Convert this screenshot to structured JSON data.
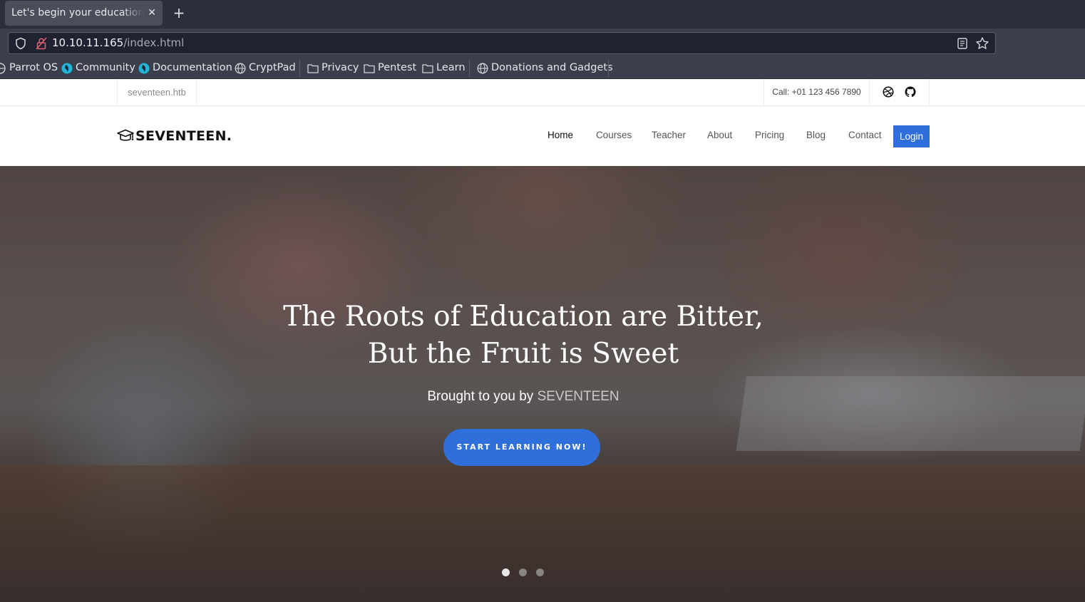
{
  "browser": {
    "tab_title": "Let's begin your education with us!",
    "tab_close": "✕",
    "new_tab": "+",
    "url_host": "10.10.11.165",
    "url_path": "/index.html"
  },
  "bookmarks": [
    {
      "label": "Parrot OS",
      "icon": "parrot-icon"
    },
    {
      "label": "Community",
      "icon": "parrot-icon"
    },
    {
      "label": "Documentation",
      "icon": "parrot-icon"
    },
    {
      "label": "CryptPad",
      "icon": "globe-icon"
    },
    {
      "label": "Privacy",
      "icon": "folder-icon"
    },
    {
      "label": "Pentest",
      "icon": "folder-icon"
    },
    {
      "label": "Learn",
      "icon": "folder-icon"
    },
    {
      "label": "Donations and Gadgets",
      "icon": "globe-icon"
    }
  ],
  "topbar": {
    "domain": "seventeen.htb",
    "phone": "Call: +01 123 456 7890",
    "social": [
      "dribbble-icon",
      "github-icon"
    ]
  },
  "header": {
    "brand": "SEVENTEEN.",
    "nav": [
      "Home",
      "Courses",
      "Teacher",
      "About",
      "Pricing",
      "Blog",
      "Contact"
    ],
    "active": "Home",
    "login": "Login"
  },
  "hero": {
    "title": "The Roots of Education are Bitter, But the Fruit is Sweet",
    "subtitle_prefix": "Brought to you by ",
    "subtitle_brand": "SEVENTEEN",
    "cta": "START LEARNING NOW!",
    "slides": 3,
    "active_slide": 1
  },
  "colors": {
    "accent": "#2f6fdc",
    "chrome_dark": "#2b2e3b",
    "chrome_mid": "#3b3e4b"
  }
}
